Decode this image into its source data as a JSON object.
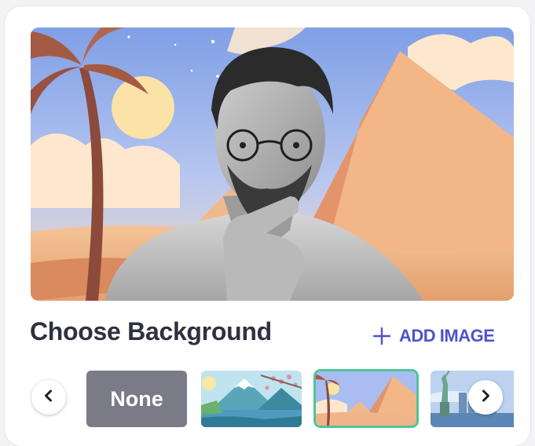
{
  "panel": {
    "title": "Choose Background",
    "add_image_label": "ADD IMAGE"
  },
  "backgrounds": {
    "options": [
      {
        "label": "None",
        "kind": "none",
        "selected": false
      },
      {
        "kind": "mountain-lake",
        "selected": false
      },
      {
        "kind": "pyramids",
        "selected": true
      },
      {
        "kind": "statue-of-liberty",
        "selected": false
      }
    ],
    "prev_icon": "chevron-left-icon",
    "next_icon": "chevron-right-icon"
  },
  "colors": {
    "accent": "#4a55c8",
    "selected_border": "#4fc49a",
    "none_tile": "#7b7a87",
    "title_text": "#2f3040"
  }
}
